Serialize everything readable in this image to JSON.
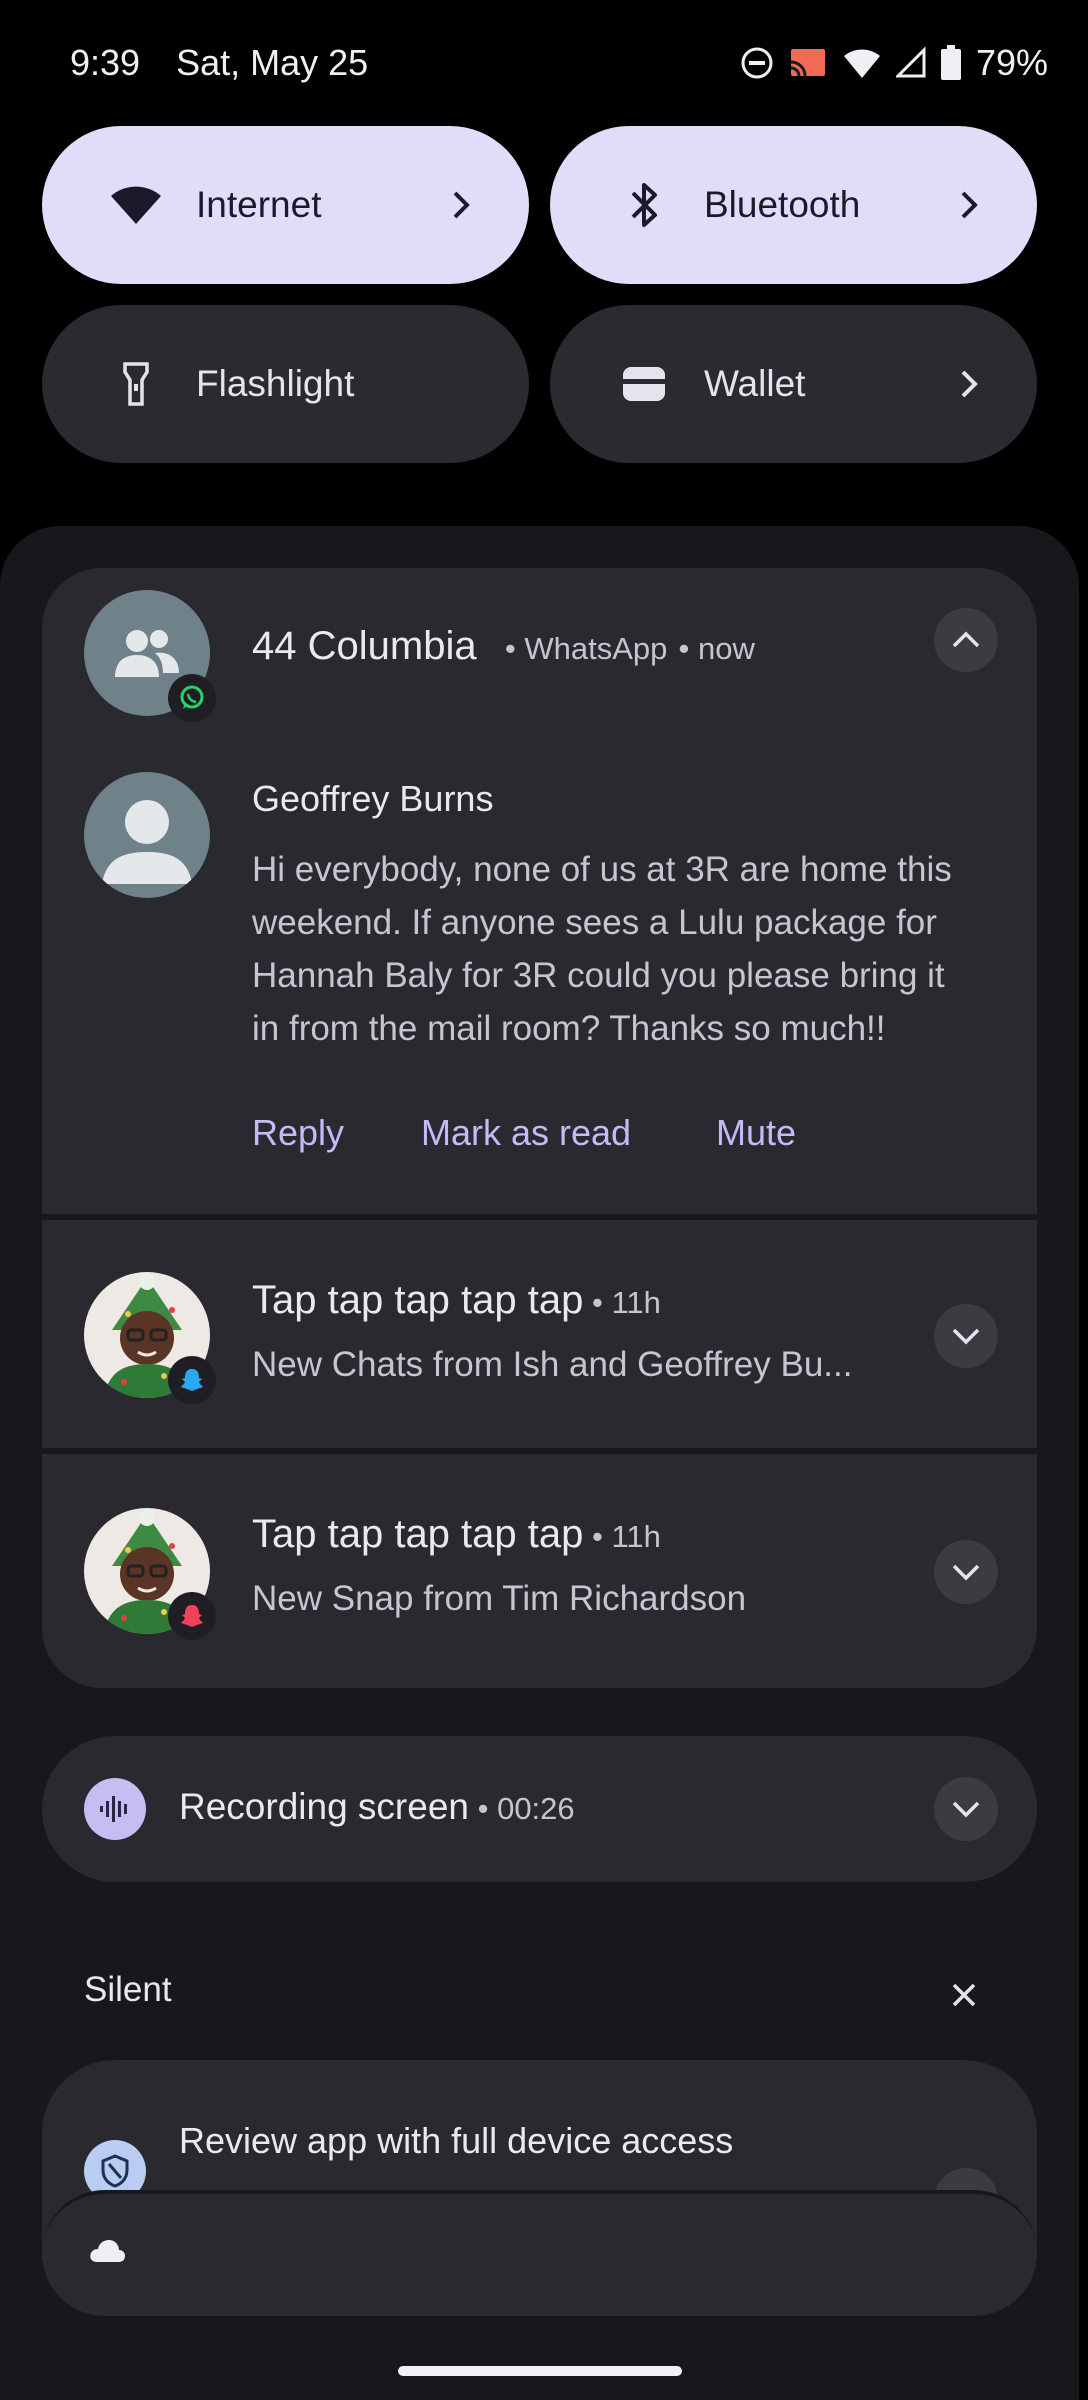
{
  "status_bar": {
    "time": "9:39",
    "date": "Sat, May 25",
    "battery": "79%",
    "icons": [
      "do-not-disturb-icon",
      "cast-icon",
      "wifi-icon",
      "cell-signal-icon",
      "battery-icon"
    ]
  },
  "quick_settings": {
    "tiles": [
      {
        "label": "Internet",
        "icon": "wifi-icon",
        "active": true,
        "has_chevron": true
      },
      {
        "label": "Bluetooth",
        "icon": "bluetooth-icon",
        "active": true,
        "has_chevron": true
      },
      {
        "label": "Flashlight",
        "icon": "flashlight-icon",
        "active": false,
        "has_chevron": false
      },
      {
        "label": "Wallet",
        "icon": "wallet-icon",
        "active": false,
        "has_chevron": true
      }
    ]
  },
  "notifications": {
    "whatsapp": {
      "title": "44 Columbia",
      "app": "WhatsApp",
      "time": "now",
      "sender": "Geoffrey Burns",
      "message_lines": [
        "Hi everybody, none of us at 3R are home this",
        "weekend. If anyone sees a Lulu package for",
        "Hannah Baly for 3R could you please bring it",
        "in from the mail room? Thanks so much!!"
      ],
      "actions": [
        "Reply",
        "Mark as read",
        "Mute"
      ]
    },
    "snap1": {
      "title": "Tap tap tap tap tap",
      "time": "11h",
      "text": "New Chats from Ish and Geoffrey Bu..."
    },
    "snap2": {
      "title": "Tap tap tap tap tap",
      "time": "11h",
      "text": "New Snap from Tim Richardson"
    },
    "recording": {
      "title": "Recording screen",
      "time": "00:26"
    },
    "silent_section": {
      "label": "Silent"
    },
    "review": {
      "title": "Review app with full device access"
    }
  },
  "colors": {
    "accent": "#c6b9f5",
    "tile_active": "#e3dcf9",
    "card": "#2a2930",
    "whatsapp_green": "#25d366",
    "snapchat_blue": "#2aa8f0",
    "snapchat_red": "#f0405a"
  }
}
